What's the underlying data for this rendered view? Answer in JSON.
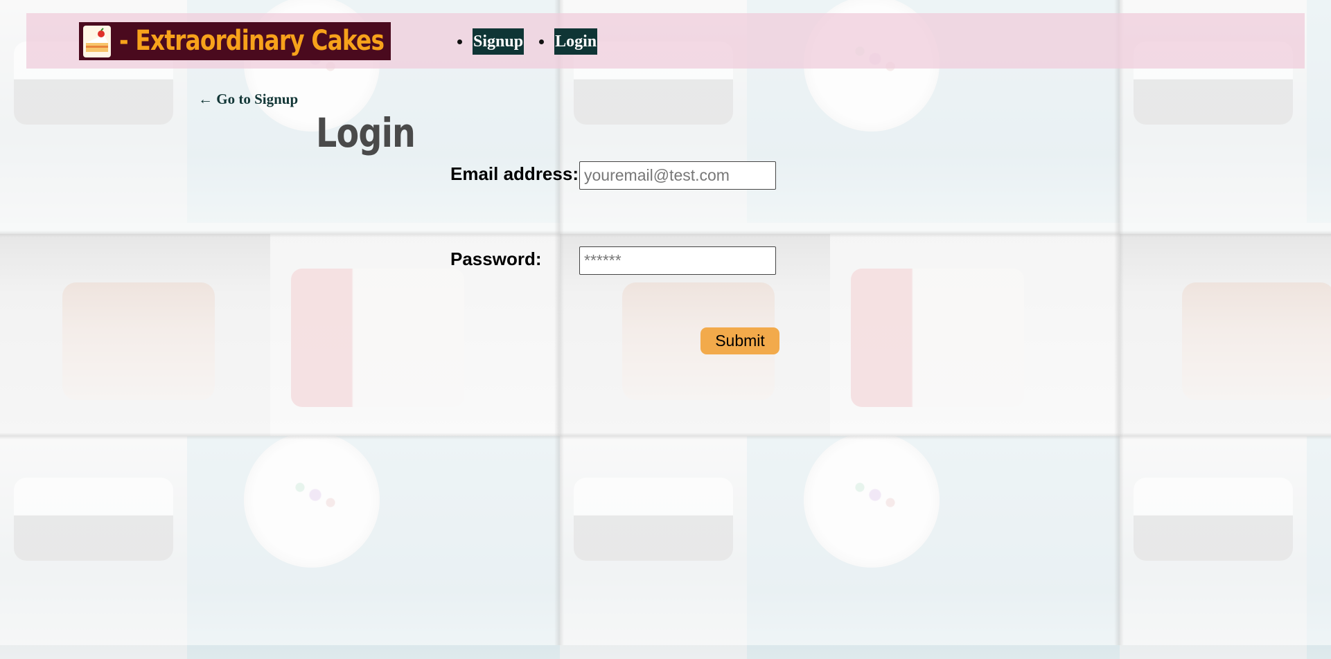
{
  "navbar": {
    "brand_text": "- Extraordinary Cakes",
    "logo_icon": "cake-slice-icon",
    "links": [
      {
        "label": "Signup"
      },
      {
        "label": "Login"
      }
    ]
  },
  "back_link": {
    "label": "← Go to Signup"
  },
  "page": {
    "title": "Login"
  },
  "form": {
    "email_label": "Email address:",
    "email_placeholder": "youremail@test.com",
    "email_value": "",
    "password_label": "Password:",
    "password_placeholder": "******",
    "password_value": "",
    "submit_label": "Submit"
  },
  "colors": {
    "navbar_bg": "#f0cedc",
    "brand_bg": "#4a0a1e",
    "brand_text": "#f7a21b",
    "nav_link_bg": "#0f3535",
    "submit_bg": "#f2aa4b"
  }
}
